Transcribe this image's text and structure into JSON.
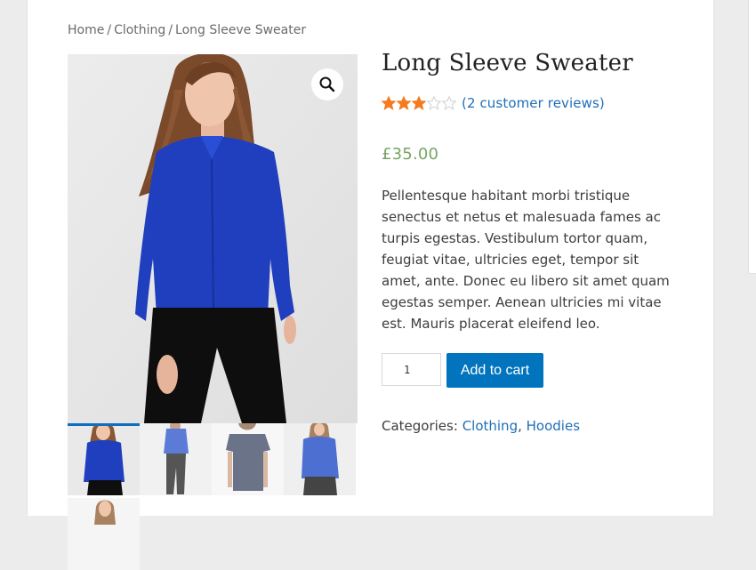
{
  "breadcrumb": {
    "items": [
      "Home",
      "Clothing",
      "Long Sleeve Sweater"
    ],
    "separator": "/"
  },
  "product": {
    "title": "Long Sleeve Sweater",
    "rating": {
      "value": 3,
      "max": 5
    },
    "reviews_link": "(2 customer reviews)",
    "price": "£35.00",
    "description": "Pellentesque habitant morbi tristique senectus et netus et malesuada fames ac turpis egestas. Vestibulum tortor quam, feugiat vitae, ultricies eget, tempor sit amet, ante. Donec eu libero sit amet quam egestas semper. Aenean ultricies mi vitae est. Mauris placerat eleifend leo.",
    "quantity": "1",
    "add_to_cart_label": "Add to cart",
    "categories_label": "Categories:",
    "categories": [
      "Clothing",
      "Hoodies"
    ],
    "category_separator": ", "
  },
  "gallery": {
    "zoom_icon": "magnifier-icon",
    "main_image": "model in blue long-sleeve shirt and black trousers",
    "thumbnails": [
      {
        "desc": "blue shirt front close",
        "active": true
      },
      {
        "desc": "blue shirt full length"
      },
      {
        "desc": "grey tee back view"
      },
      {
        "desc": "blue shirt front side"
      },
      {
        "desc": "model portrait"
      }
    ]
  },
  "colors": {
    "accent": "#0274be",
    "link": "#1e6fb8",
    "price": "#77a464",
    "star_filled": "#f47b20",
    "star_empty": "#d0d0d0"
  }
}
